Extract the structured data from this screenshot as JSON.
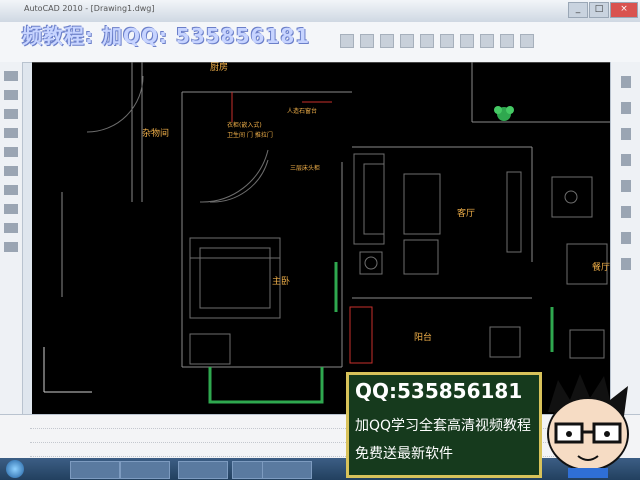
{
  "window": {
    "title": "AutoCAD 2010 - [Drawing1.dwg]"
  },
  "watermark": {
    "text": "频教程: 加QQ: 535856181"
  },
  "rooms": {
    "storage": "杂物间",
    "bedroom": "主卧",
    "living": "客厅",
    "balcony": "阳台",
    "partial_top": "厨房",
    "partial_right": "餐厅"
  },
  "annotations": [
    "衣柜(嵌入式)",
    "卫生间 门 推拉门",
    "人造石窗台",
    "三层床头柜"
  ],
  "promo": {
    "qq": "QQ:535856181",
    "line1": "加QQ学习全套高清视频教程",
    "line2": "免费送最新软件"
  },
  "taskbar": {
    "items": [
      "",
      "",
      "",
      "",
      ""
    ]
  },
  "colors": {
    "canvas": "#000000",
    "label": "#f2b14a",
    "promo_bg": "#163a1d",
    "promo_border": "#d8c25a"
  }
}
